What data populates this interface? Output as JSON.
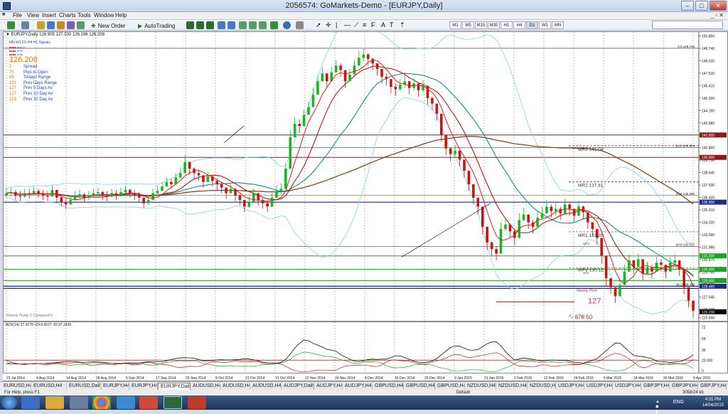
{
  "window": {
    "title": "2056574: GoMarkets-Demo - [EURJPY,Daily]"
  },
  "menu": [
    "File",
    "View",
    "Insert",
    "Charts",
    "Tools",
    "Window",
    "Help"
  ],
  "toolbar": {
    "new_order": "New Order",
    "autotrading": "AutoTrading",
    "timeframes": [
      "M1",
      "M5",
      "M15",
      "M30",
      "H1",
      "H4",
      "D1",
      "W1",
      "MN"
    ]
  },
  "chart": {
    "symbol_line": "EURJPY,Daily  126.905 127.030 126.196 126.208",
    "indicator_mini": [
      "MN",
      "W1",
      "D1",
      "H4",
      "H1",
      "Signals"
    ],
    "indicator_mini_colors": [
      "#1a3fd8",
      "#1a3fd8",
      "#1a3fd8",
      "#1a3fd8",
      "#1a3fd8",
      "#1a3fd8"
    ],
    "indicator_small": [
      "MACD",
      "STR",
      "EMA"
    ],
    "price_big": "126.208",
    "stats": [
      {
        "value": "2",
        "label": "Spread"
      },
      {
        "value": "70",
        "label": "Pips to Open"
      },
      {
        "value": "83",
        "label": "Todays Range"
      },
      {
        "value": "131",
        "label": "Prev Days Range"
      },
      {
        "value": "127",
        "label": "Prev 5 Days Av"
      },
      {
        "value": "127",
        "label": "Prev 10 Day Av"
      },
      {
        "value": "153",
        "label": "Prev 30 Day Av"
      }
    ],
    "bottom_label": "Weekly Pivots © CompassFX",
    "annotations": {
      "fib0": "0.0  149.746",
      "fib618": "61.8  140.884",
      "fib236": "23.6  136.600",
      "fib50": "50.0  132.037",
      "fib382": "38.2  128.489",
      "mr3": "MR3  141.04",
      "mr2": "MR2  137.81",
      "mr1": "MR1  133.35",
      "mpv": "MPV  130.12",
      "wr1": "wR1",
      "wr2": "wR2",
      "weekly_pivot": "Weekly Pivot",
      "big127": "127",
      "bottom_red": "^- 878:50"
    },
    "axis_prices": [
      "150.850",
      "149.740",
      "148.630",
      "147.520",
      "146.410",
      "145.300",
      "144.190",
      "143.080",
      "141.970",
      "140.860",
      "139.750",
      "138.640",
      "137.530",
      "136.420",
      "135.310",
      "134.200",
      "133.090",
      "131.980",
      "130.870",
      "129.760",
      "128.650",
      "127.540",
      "126.430",
      "125.690"
    ],
    "axis_price_values": [
      150.85,
      149.74,
      148.63,
      147.52,
      146.41,
      145.3,
      144.19,
      143.08,
      141.97,
      140.86,
      139.75,
      138.64,
      137.53,
      136.42,
      135.31,
      134.2,
      133.09,
      131.98,
      130.87,
      129.76,
      128.65,
      127.54,
      126.43,
      125.69
    ],
    "highlight_prices": [
      {
        "label": "142.000",
        "value": 142.0,
        "color": "#8b1a1a"
      },
      {
        "label": "140.000",
        "value": 140.0,
        "color": "#8b1a1a"
      },
      {
        "label": "136.000",
        "value": 136.0,
        "color": "#1c2a8c"
      },
      {
        "label": "131.200",
        "value": 131.2,
        "color": "#15a61d"
      },
      {
        "label": "130.000",
        "value": 130.0,
        "color": "#15a61d"
      },
      {
        "label": "129.000",
        "value": 129.0,
        "color": "#15a61d"
      },
      {
        "label": "128.489",
        "value": 128.489,
        "color": "#1c2a8c"
      },
      {
        "label": "126.208",
        "value": 126.208,
        "color": "#000000"
      }
    ],
    "hlines": [
      {
        "value": 149.746,
        "color": "#444444",
        "width": 0.8
      },
      {
        "value": 142.0,
        "color": "#8b1a1a",
        "width": 1
      },
      {
        "value": 140.884,
        "color": "#444444",
        "width": 0.6
      },
      {
        "value": 140.0,
        "color": "#8b1a1a",
        "width": 1
      },
      {
        "value": 136.6,
        "color": "#444444",
        "width": 0.6
      },
      {
        "value": 136.0,
        "color": "#1c2a8c",
        "width": 1.2
      },
      {
        "value": 132.037,
        "color": "#444444",
        "width": 0.6
      },
      {
        "value": 131.2,
        "color": "#15a61d",
        "width": 1
      },
      {
        "value": 130.0,
        "color": "#15a61d",
        "width": 1
      },
      {
        "value": 129.0,
        "color": "#15a61d",
        "width": 1
      },
      {
        "value": 128.489,
        "color": "#1c2a8c",
        "width": 1.2
      },
      {
        "value": 128.3,
        "color": "#1c2a8c",
        "width": 1.2
      }
    ],
    "price_range": [
      125.4,
      151.2
    ],
    "pivots": [
      {
        "name": "mr3",
        "value": 141.04,
        "color": "#8b1a1a"
      },
      {
        "name": "mr2",
        "value": 137.81,
        "color": "#8b1a1a"
      },
      {
        "name": "mr1",
        "value": 133.35,
        "color": "#c0307a"
      },
      {
        "name": "mpv",
        "value": 130.12,
        "color": "#c0307a"
      }
    ],
    "adx_label": "ADX(14) 37.4278 +DI:8.6527 -DI:37.2439",
    "adx_axis": [
      "72",
      "54",
      "36",
      "20.000",
      "0"
    ],
    "adx_axis_values": [
      72,
      54,
      36,
      20,
      0
    ],
    "adx_range": [
      0,
      80
    ]
  },
  "xaxis": [
    "23 Jul 2014",
    "4 Aug 2014",
    "14 Aug 2014",
    "26 Aug 2014",
    "5 Sep 2014",
    "17 Sep 2014",
    "29 Sep 2014",
    "9 Oct 2014",
    "21 Oct 2014",
    "31 Oct 2014",
    "12 Nov 2014",
    "24 Nov 2014",
    "4 Dec 2014",
    "16 Dec 2014",
    "29 Dec 2014",
    "9 Jan 2015",
    "21 Jan 2015",
    "2 Feb 2015",
    "12 Feb 2015",
    "24 Feb 2015",
    "6 Mar 2015",
    "18 Mar 2015",
    "30 Mar 2015",
    "9 Apr 2015"
  ],
  "series_close": [
    136.8,
    136.9,
    136.6,
    136.5,
    136.8,
    136.7,
    137.0,
    136.8,
    136.6,
    136.5,
    137.1,
    136.4,
    136.0,
    135.8,
    136.2,
    136.6,
    136.7,
    136.4,
    136.6,
    136.8,
    136.9,
    136.6,
    136.5,
    136.8,
    136.6,
    136.9,
    137.1,
    136.8,
    136.6,
    136.4,
    135.9,
    136.2,
    136.8,
    137.0,
    137.4,
    137.8,
    137.6,
    138.2,
    138.6,
    139.6,
    139.0,
    138.6,
    138.4,
    137.8,
    138.3,
    137.9,
    137.6,
    137.3,
    136.8,
    137.2,
    136.6,
    136.2,
    135.6,
    136.0,
    136.8,
    136.2,
    135.9,
    135.6,
    136.4,
    137.0,
    137.2,
    139.0,
    141.8,
    143.0,
    142.8,
    143.8,
    144.5,
    145.6,
    146.8,
    147.5,
    146.8,
    147.6,
    148.2,
    147.8,
    146.8,
    147.4,
    148.2,
    148.9,
    149.2,
    148.8,
    148.4,
    147.9,
    147.2,
    147.0,
    146.3,
    146.1,
    146.5,
    146.8,
    146.2,
    146.6,
    146.0,
    146.4,
    145.3,
    144.8,
    143.9,
    142.0,
    140.8,
    140.3,
    140.6,
    139.8,
    138.8,
    137.6,
    136.4,
    135.6,
    133.8,
    132.4,
    131.8,
    131.4,
    133.6,
    134.0,
    133.4,
    132.8,
    134.4,
    134.9,
    134.2,
    133.8,
    134.6,
    135.0,
    135.6,
    135.2,
    135.4,
    135.0,
    135.8,
    135.4,
    134.8,
    135.6,
    135.1,
    134.2,
    133.6,
    132.8,
    131.2,
    129.2,
    128.4,
    127.6,
    128.6,
    129.8,
    130.8,
    130.2,
    130.9,
    129.6,
    130.2,
    129.8,
    130.6,
    130.4,
    129.8,
    130.6,
    130.8,
    130.0,
    128.4,
    127.2,
    126.3
  ],
  "series_high": [
    137.3,
    137.3,
    137.1,
    137.0,
    137.2,
    137.2,
    137.4,
    137.2,
    137.1,
    137.0,
    137.5,
    137.0,
    136.5,
    136.3,
    136.6,
    137.0,
    137.1,
    136.8,
    137.0,
    137.2,
    137.3,
    137.0,
    137.0,
    137.2,
    137.1,
    137.3,
    137.5,
    137.2,
    137.1,
    136.9,
    136.4,
    136.6,
    137.2,
    137.5,
    137.8,
    138.2,
    138.1,
    138.6,
    139.1,
    140.2,
    139.5,
    139.1,
    138.9,
    138.3,
    138.7,
    138.4,
    138.1,
    137.8,
    137.3,
    137.6,
    137.1,
    136.7,
    136.1,
    136.5,
    137.2,
    136.7,
    136.4,
    136.1,
    136.8,
    137.5,
    137.7,
    139.5,
    142.4,
    143.6,
    143.4,
    144.3,
    145.0,
    146.2,
    147.3,
    148.1,
    147.4,
    148.1,
    148.7,
    148.4,
    147.4,
    147.9,
    148.7,
    149.5,
    149.7,
    149.3,
    148.9,
    148.4,
    147.7,
    147.5,
    146.8,
    146.6,
    147.0,
    147.3,
    146.7,
    147.1,
    146.6,
    146.9,
    145.9,
    145.4,
    144.5,
    142.7,
    141.5,
    140.9,
    141.1,
    140.4,
    139.5,
    138.3,
    137.1,
    136.3,
    134.6,
    133.2,
    132.5,
    132.1,
    134.2,
    134.6,
    134.1,
    133.5,
    135.0,
    135.5,
    134.8,
    134.4,
    135.2,
    135.6,
    136.2,
    135.8,
    136.0,
    135.6,
    136.3,
    136.0,
    135.4,
    136.1,
    135.7,
    134.8,
    134.2,
    133.5,
    132.0,
    129.9,
    129.1,
    128.4,
    129.2,
    130.4,
    131.3,
    130.8,
    131.4,
    130.2,
    130.7,
    130.4,
    131.1,
    130.9,
    130.4,
    131.1,
    131.3,
    130.6,
    129.2,
    128.0,
    127.0
  ],
  "series_low": [
    136.4,
    136.5,
    136.2,
    136.1,
    136.4,
    136.3,
    136.6,
    136.4,
    136.2,
    136.1,
    136.7,
    136.0,
    135.6,
    135.4,
    135.8,
    136.2,
    136.3,
    136.0,
    136.2,
    136.4,
    136.5,
    136.2,
    136.1,
    136.4,
    136.2,
    136.5,
    136.7,
    136.4,
    136.2,
    136.0,
    135.5,
    135.8,
    136.4,
    136.6,
    137.0,
    137.4,
    137.2,
    137.8,
    138.2,
    139.0,
    138.5,
    138.1,
    137.9,
    137.3,
    137.8,
    137.4,
    137.1,
    136.8,
    136.3,
    136.8,
    136.1,
    135.7,
    135.1,
    135.5,
    136.3,
    135.7,
    135.4,
    135.1,
    135.9,
    136.5,
    136.7,
    138.5,
    141.2,
    142.4,
    142.2,
    143.2,
    143.9,
    145.0,
    146.2,
    146.9,
    146.2,
    147.0,
    147.6,
    147.2,
    146.2,
    146.8,
    147.6,
    148.3,
    148.6,
    148.2,
    147.8,
    147.3,
    146.6,
    146.4,
    145.7,
    145.5,
    145.9,
    146.2,
    145.6,
    146.0,
    145.4,
    145.8,
    144.7,
    144.2,
    143.3,
    141.4,
    140.2,
    139.6,
    140.0,
    139.2,
    138.2,
    137.0,
    135.8,
    134.9,
    133.1,
    131.7,
    131.2,
    130.8,
    132.9,
    133.4,
    132.8,
    132.2,
    133.8,
    134.3,
    133.6,
    133.2,
    134.0,
    134.4,
    135.0,
    134.6,
    134.8,
    134.4,
    135.2,
    134.8,
    134.2,
    135.0,
    134.5,
    133.6,
    133.0,
    132.2,
    130.5,
    128.5,
    127.8,
    127.0,
    128.0,
    129.2,
    130.2,
    129.6,
    130.3,
    129.0,
    129.6,
    129.2,
    130.0,
    129.8,
    129.2,
    130.0,
    130.2,
    129.4,
    127.8,
    126.6,
    125.7
  ]
}
